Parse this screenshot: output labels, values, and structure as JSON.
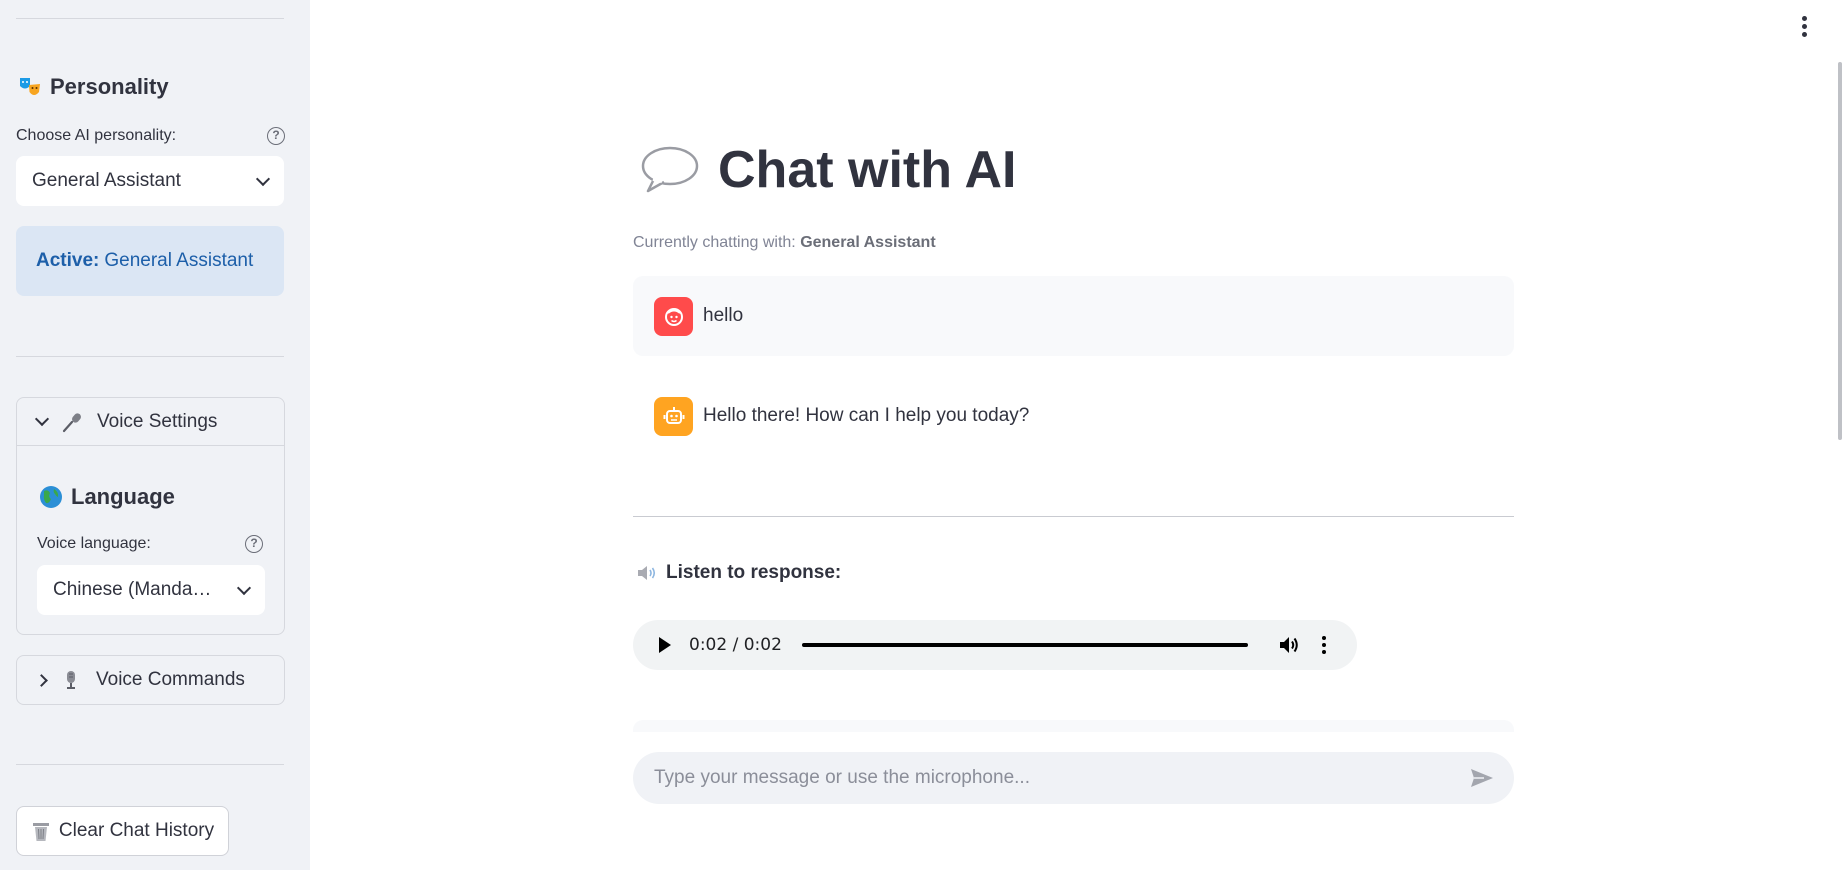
{
  "sidebar": {
    "personality_heading": "Personality",
    "choose_label": "Choose AI personality:",
    "personality_selected": "General Assistant",
    "active_label": "Active:",
    "active_value": "General Assistant",
    "voice_settings_label": "Voice Settings",
    "language_heading": "Language",
    "voice_language_label": "Voice language:",
    "voice_language_selected": "Chinese (Manda…",
    "voice_commands_label": "Voice Commands",
    "clear_button": "Clear Chat History"
  },
  "main": {
    "title": "Chat with AI",
    "subtitle_prefix": "Currently chatting with:",
    "subtitle_value": "General Assistant",
    "messages": [
      {
        "role": "user",
        "text": "hello"
      },
      {
        "role": "assistant",
        "text": "Hello there! How can I help you today?"
      }
    ],
    "listen_label": "Listen to response:",
    "audio_time": "0:02 / 0:02",
    "audio_progress": 1.0,
    "input_placeholder": "Type your message or use the microphone..."
  },
  "colors": {
    "sidebar_bg": "#f0f2f6",
    "info_bg": "#dbe6f4",
    "info_text": "#1d5fa9",
    "user_avatar": "#ff4b4b",
    "assistant_avatar": "#ffa421"
  },
  "icons": {
    "personality": "theater-masks-icon",
    "voice_settings": "microphone-icon",
    "language": "globe-icon",
    "voice_commands": "studio-microphone-icon",
    "clear": "wastebasket-icon",
    "title": "speech-balloon-icon",
    "listen": "speaker-icon"
  }
}
